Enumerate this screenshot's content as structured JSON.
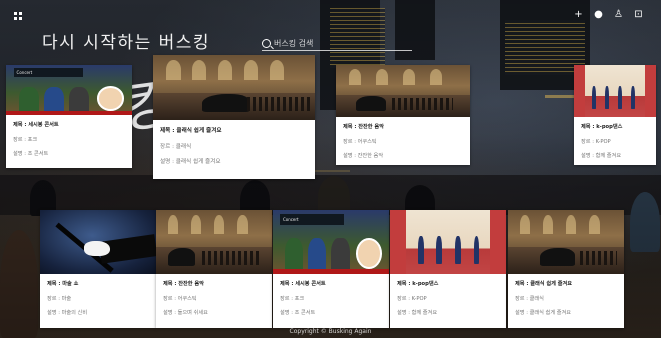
{
  "site": {
    "title": "다시 시작하는 버스킹",
    "search_placeholder": "버스킹 검색"
  },
  "header_icons": [
    "plus-icon",
    "bell-icon",
    "user-icon",
    "lock-icon"
  ],
  "labels": {
    "title": "제목 : ",
    "genre": "장르 : ",
    "desc": "설명 : "
  },
  "cards_top": [
    {
      "title": "제목 : 세시봉 콘서트",
      "genre": "장르 : 포크",
      "desc": "설명 : 조 콘서트",
      "thumb": "street"
    },
    {
      "title": "제목 : 클래식 쉽게 즐겨요",
      "genre": "장르 : 클래식",
      "desc": "설명 : 클래식 쉽게 즐겨요",
      "thumb": "hall"
    },
    {
      "title": "제목 : 잔잔한 음악",
      "genre": "장르 : 어쿠스틱",
      "desc": "설명 : 잔잔한 음악",
      "thumb": "hall"
    },
    {
      "title": "제목 : k-pop댄스",
      "genre": "장르 : K-POP",
      "desc": "설명 : 함께 즐겨요",
      "thumb": "kpop"
    }
  ],
  "cards_bottom": [
    {
      "title": "제목 : 마술 쇼",
      "genre": "장르 : 마술",
      "desc": "설명 : 마술의 신비",
      "thumb": "magic"
    },
    {
      "title": "제목 : 잔잔한 음악",
      "genre": "장르 : 어쿠스틱",
      "desc": "설명 : 들으며 쉬세요",
      "thumb": "hall"
    },
    {
      "title": "제목 : 세시봉 콘서트",
      "genre": "장르 : 포크",
      "desc": "설명 : 조 콘서트",
      "thumb": "street"
    },
    {
      "title": "제목 : k-pop댄스",
      "genre": "장르 : K-POP",
      "desc": "설명 : 함께 즐겨요",
      "thumb": "kpop"
    },
    {
      "title": "제목 : 클래식 쉽게 즐겨요",
      "genre": "장르 : 클래식",
      "desc": "설명 : 클래식 쉽게 즐겨요",
      "thumb": "hall"
    }
  ],
  "footer": {
    "text": "Copyright © Busking Again"
  },
  "colors": {
    "card_bg": "#ffffff",
    "title_text": "#f1f1f1"
  }
}
